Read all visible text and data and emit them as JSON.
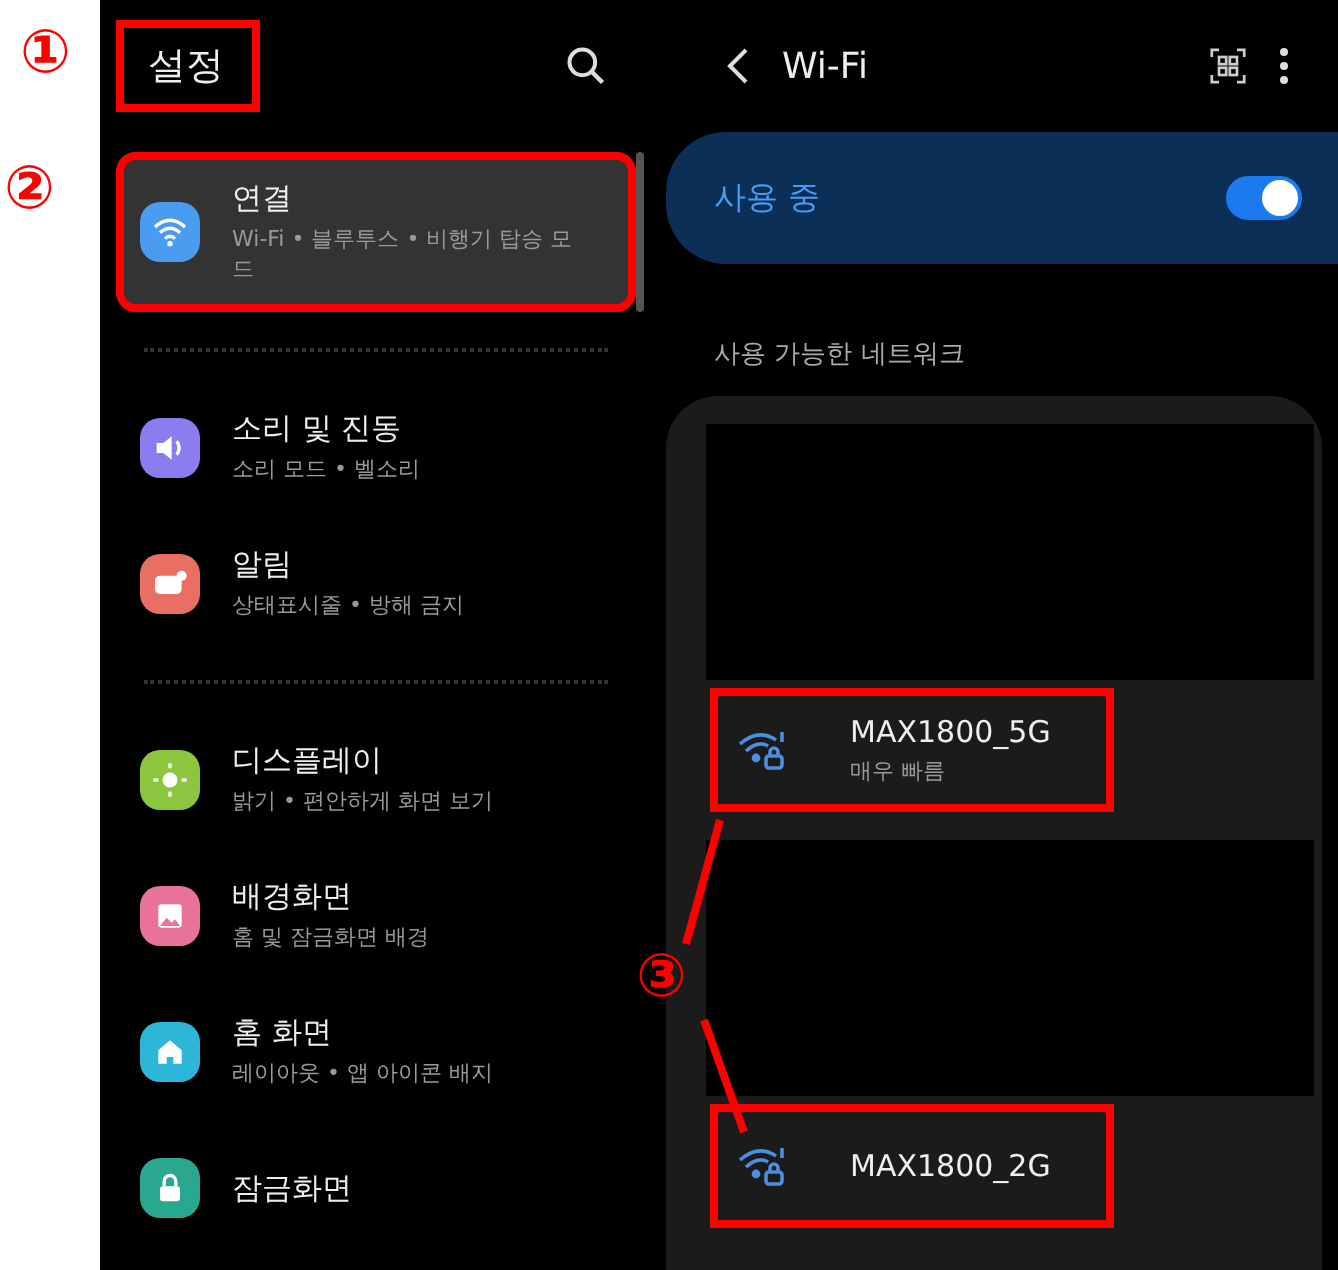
{
  "settings": {
    "title": "설정",
    "title_highlighted": true,
    "title_callout": "①",
    "groups": [
      [
        {
          "kind": "wifi",
          "color": "#4a9cf0",
          "title": "연결",
          "subtitle": "Wi-Fi • 블루투스 • 비행기 탑승 모드",
          "selected": true,
          "highlighted": true,
          "callout": "②"
        }
      ],
      [
        {
          "kind": "sound",
          "color": "#8b7cf0",
          "title": "소리 및 진동",
          "subtitle": "소리 모드 • 벨소리",
          "selected": false,
          "highlighted": false
        },
        {
          "kind": "bell",
          "color": "#e86f62",
          "title": "알림",
          "subtitle": "상태표시줄 • 방해 금지",
          "selected": false,
          "highlighted": false
        }
      ],
      [
        {
          "kind": "sun",
          "color": "#8cc63f",
          "title": "디스플레이",
          "subtitle": "밝기 • 편안하게 화면 보기",
          "selected": false,
          "highlighted": false
        },
        {
          "kind": "picture",
          "color": "#e9739a",
          "title": "배경화면",
          "subtitle": "홈 및 잠금화면 배경",
          "selected": false,
          "highlighted": false
        },
        {
          "kind": "home",
          "color": "#2eb6d8",
          "title": "홈 화면",
          "subtitle": "레이아웃 • 앱 아이콘 배지",
          "selected": false,
          "highlighted": false
        },
        {
          "kind": "lock",
          "color": "#2aa88f",
          "title": "잠금화면",
          "selected": false,
          "highlighted": false
        }
      ]
    ]
  },
  "wifi": {
    "title": "Wi-Fi",
    "status": "사용 중",
    "on": true,
    "section_label": "사용 가능한 네트워크",
    "networks_callout": "③",
    "networks": [
      {
        "kind": "hidden"
      },
      {
        "kind": "network",
        "name": "MAX1800_5G",
        "subtitle": "매우 빠름",
        "highlighted": true
      },
      {
        "kind": "hidden"
      },
      {
        "kind": "network",
        "name": "MAX1800_2G",
        "highlighted": true
      }
    ]
  }
}
